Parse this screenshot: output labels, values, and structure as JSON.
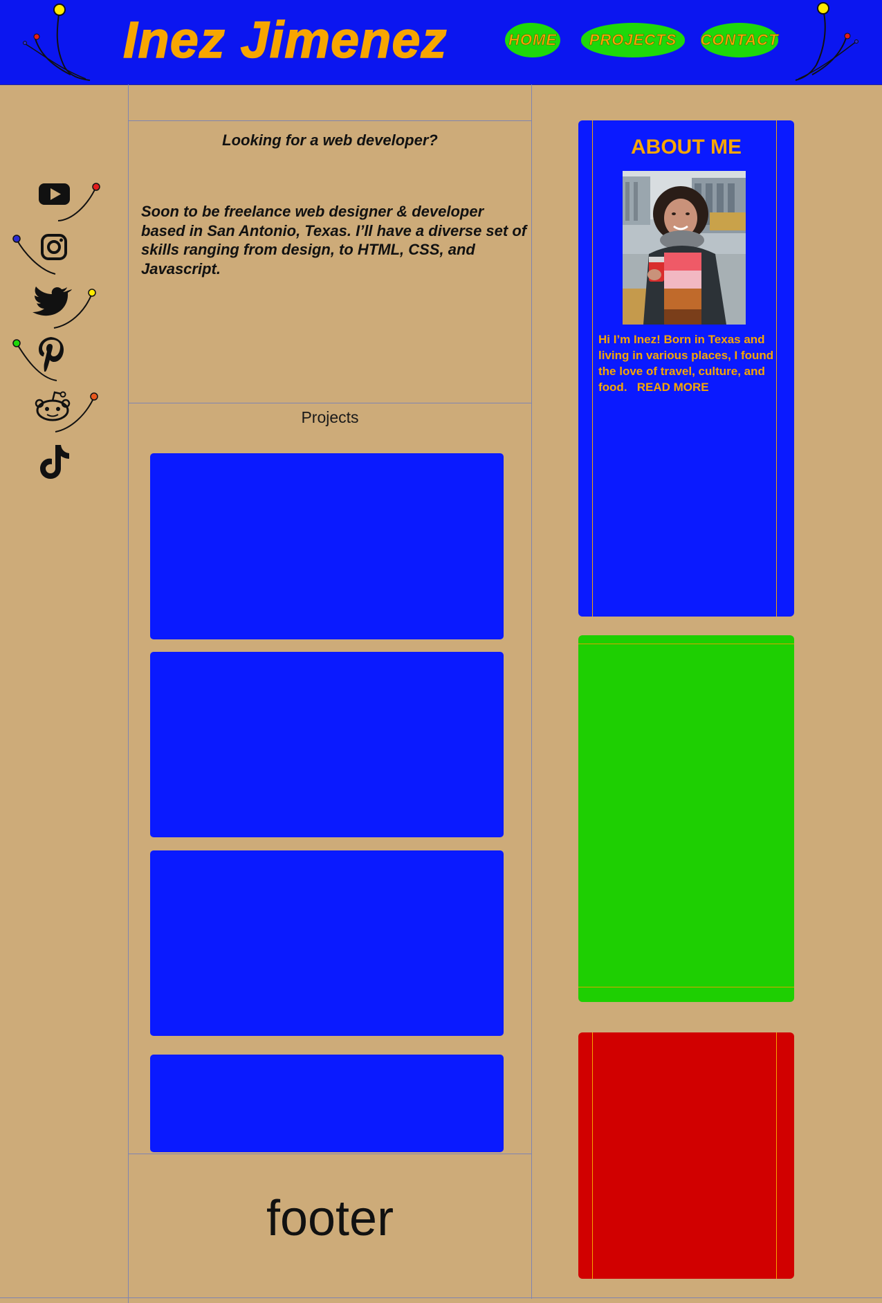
{
  "header": {
    "site_title": "Inez Jimenez",
    "nav": [
      {
        "label": "HOME"
      },
      {
        "label": "PROJECTS"
      },
      {
        "label": "CONTACT"
      }
    ]
  },
  "social": {
    "icons": [
      "youtube-icon",
      "instagram-icon",
      "twitter-icon",
      "pinterest-icon",
      "reddit-icon",
      "tiktok-icon"
    ]
  },
  "intro": {
    "heading": "Looking for a web developer?",
    "body": "Soon to be freelance web designer & developer based in San Antonio, Texas. I’ll have a diverse set of skills ranging from design, to HTML, CSS, and Javascript."
  },
  "projects": {
    "title": "Projects",
    "cards": 4
  },
  "footer": {
    "text": "footer"
  },
  "about": {
    "title": "ABOUT ME",
    "text": "Hi I’m Inez! Born in Texas and living in various places, I found the love of travel, culture, and food.",
    "read_more": "READ MORE"
  },
  "colors": {
    "header_bg": "#0b16f0",
    "page_bg": "#cdab79",
    "accent_orange": "#f7a600",
    "nav_green": "#1ed80a",
    "card_blue": "#0a1aff",
    "card_green": "#1ecf02",
    "card_red": "#d10000"
  }
}
